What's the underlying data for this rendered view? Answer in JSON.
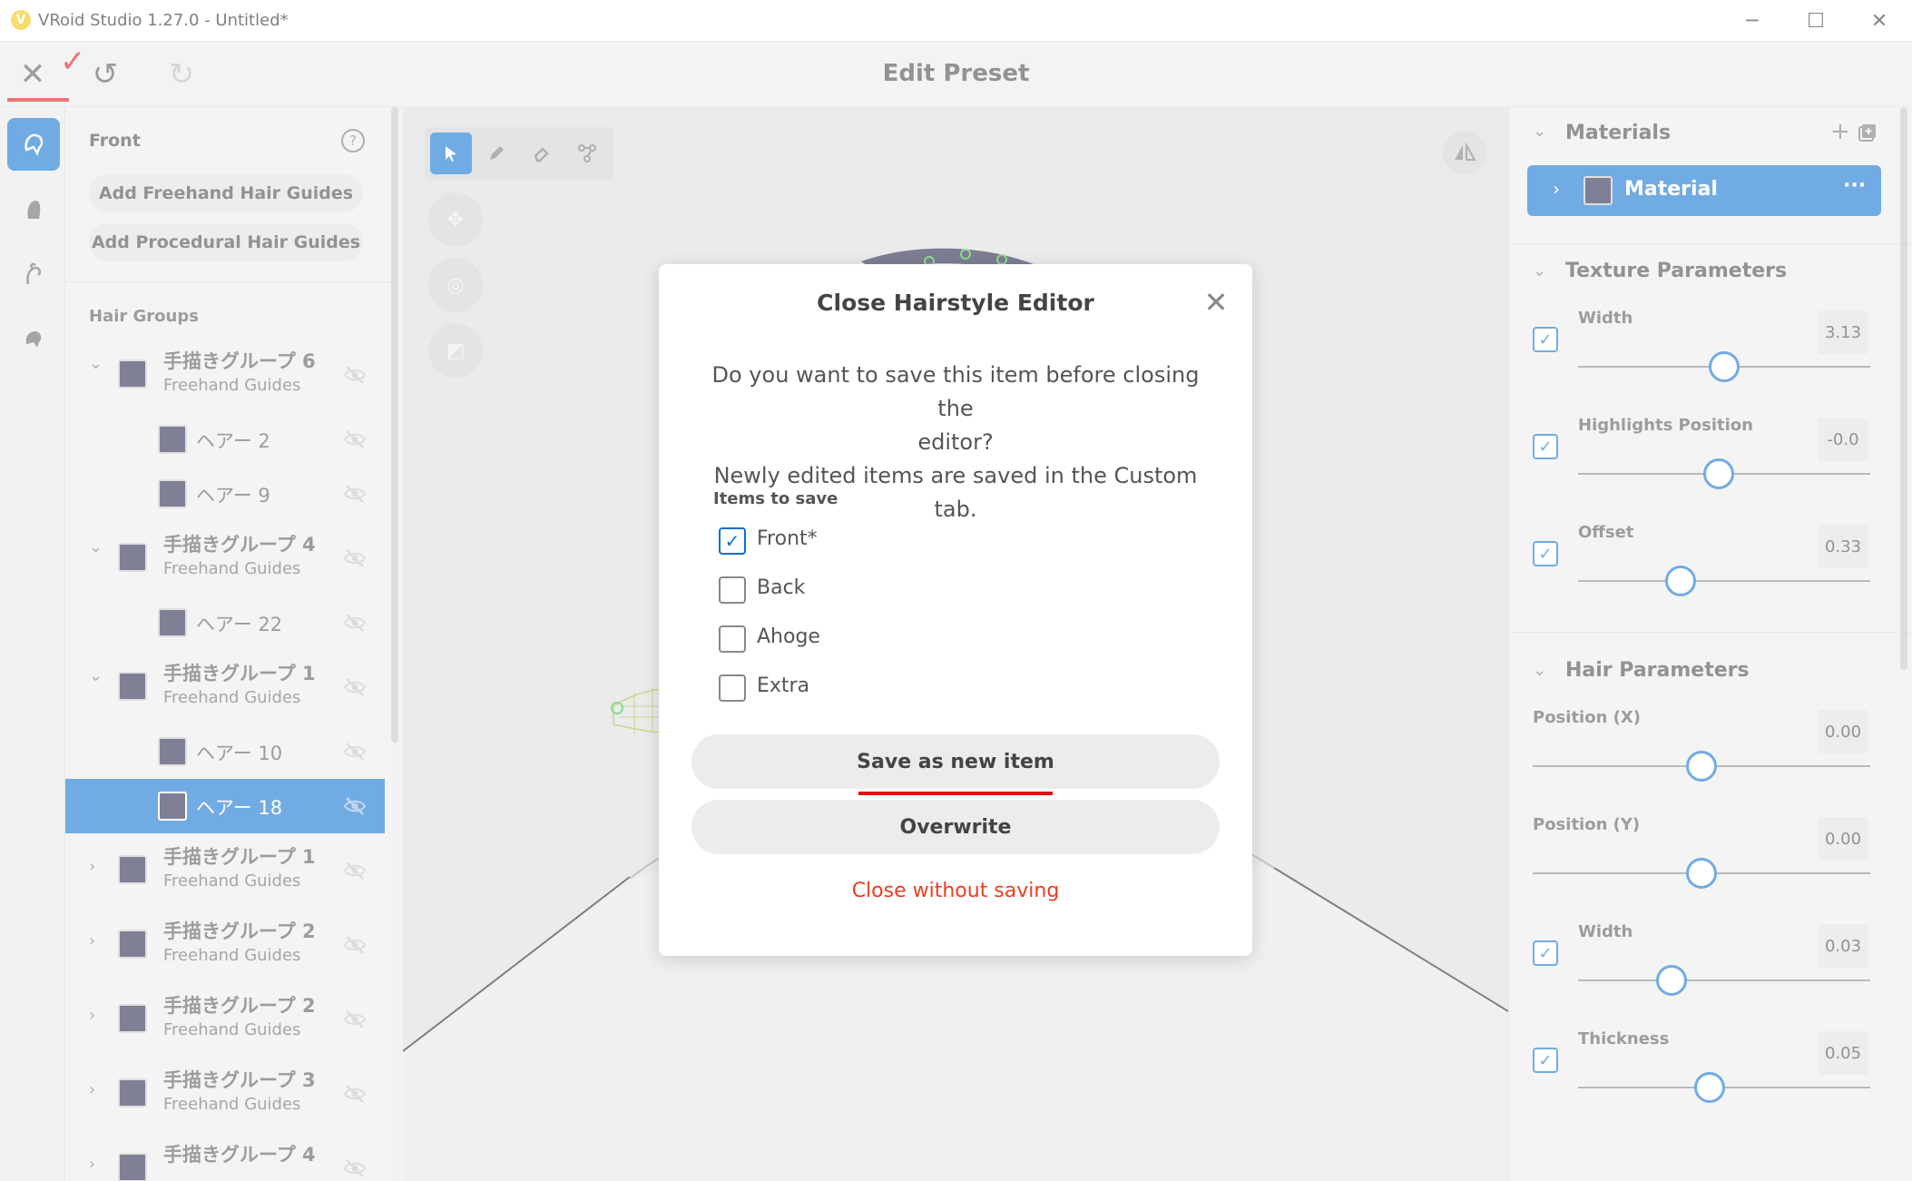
{
  "window": {
    "title": "VRoid Studio 1.27.0 - Untitled*",
    "minimize": "─",
    "maximize": "☐",
    "close": "✕"
  },
  "toolbar": {
    "close_label": "✕",
    "check_mark": "✓",
    "undo": "↺",
    "redo": "↻",
    "title": "Edit Preset"
  },
  "rail": [
    "hair-front-icon",
    "hair-back-icon",
    "ahoge-icon",
    "hair-extra-icon"
  ],
  "left_panel": {
    "heading": "Front",
    "help": "?",
    "add_freehand": "Add Freehand Hair Guides",
    "add_procedural": "Add Procedural Hair Guides",
    "hair_groups_label": "Hair Groups",
    "rows": [
      {
        "type": "group",
        "name": "手描きグループ 6",
        "sub": "Freehand Guides",
        "chevron": "⌄"
      },
      {
        "type": "hair",
        "name": "ヘアー 2"
      },
      {
        "type": "hair",
        "name": "ヘアー 9"
      },
      {
        "type": "group",
        "name": "手描きグループ 4",
        "sub": "Freehand Guides",
        "chevron": "⌄"
      },
      {
        "type": "hair",
        "name": "ヘアー 22"
      },
      {
        "type": "group",
        "name": "手描きグループ 1",
        "sub": "Freehand Guides",
        "chevron": "⌄"
      },
      {
        "type": "hair",
        "name": "ヘアー 10"
      },
      {
        "type": "hair",
        "name": "ヘアー 18",
        "selected": true
      },
      {
        "type": "group",
        "name": "手描きグループ 1",
        "sub": "Freehand Guides",
        "chevron": "›"
      },
      {
        "type": "group",
        "name": "手描きグループ 2",
        "sub": "Freehand Guides",
        "chevron": "›"
      },
      {
        "type": "group",
        "name": "手描きグループ 2",
        "sub": "Freehand Guides",
        "chevron": "›"
      },
      {
        "type": "group",
        "name": "手描きグループ 3",
        "sub": "Freehand Guides",
        "chevron": "›"
      },
      {
        "type": "group",
        "name": "手描きグループ 4",
        "sub": "",
        "chevron": "›"
      }
    ]
  },
  "right_panel": {
    "materials": {
      "heading": "Materials",
      "add": "+",
      "chevron": "⌄",
      "item": {
        "label": "Material",
        "more": "···",
        "chevron": "›"
      }
    },
    "texture": {
      "heading": "Texture Parameters",
      "params": [
        {
          "label": "Width",
          "value": "3.13",
          "position": 0.5
        },
        {
          "label": "Highlights Position",
          "value": "-0.0",
          "position": 0.48
        },
        {
          "label": "Offset",
          "value": "0.33",
          "position": 0.35
        }
      ]
    },
    "hair": {
      "heading": "Hair Parameters",
      "params": [
        {
          "label": "Position (X)",
          "value": "0.00",
          "position": 0.5
        },
        {
          "label": "Position (Y)",
          "value": "0.00",
          "position": 0.5
        },
        {
          "label": "Width",
          "value": "0.03",
          "position": 0.32
        },
        {
          "label": "Thickness",
          "value": "0.05",
          "position": 0.45
        }
      ]
    }
  },
  "modal": {
    "title": "Close Hairstyle Editor",
    "close": "✕",
    "message_line1": "Do you want to save this item before closing the",
    "message_line2": "editor?",
    "message_line3": "Newly edited items are saved in the Custom tab.",
    "items_label": "Items to save",
    "items": [
      {
        "label": "Front*",
        "checked": true
      },
      {
        "label": "Back",
        "checked": false
      },
      {
        "label": "Ahoge",
        "checked": false
      },
      {
        "label": "Extra",
        "checked": false
      }
    ],
    "save_new": "Save as new item",
    "overwrite": "Overwrite",
    "close_without_saving": "Close without saving"
  },
  "colors": {
    "accent": "#0b6fd0",
    "annotation_red": "#e01010",
    "danger_text": "#f03c1c",
    "swatch": "#24244a"
  }
}
